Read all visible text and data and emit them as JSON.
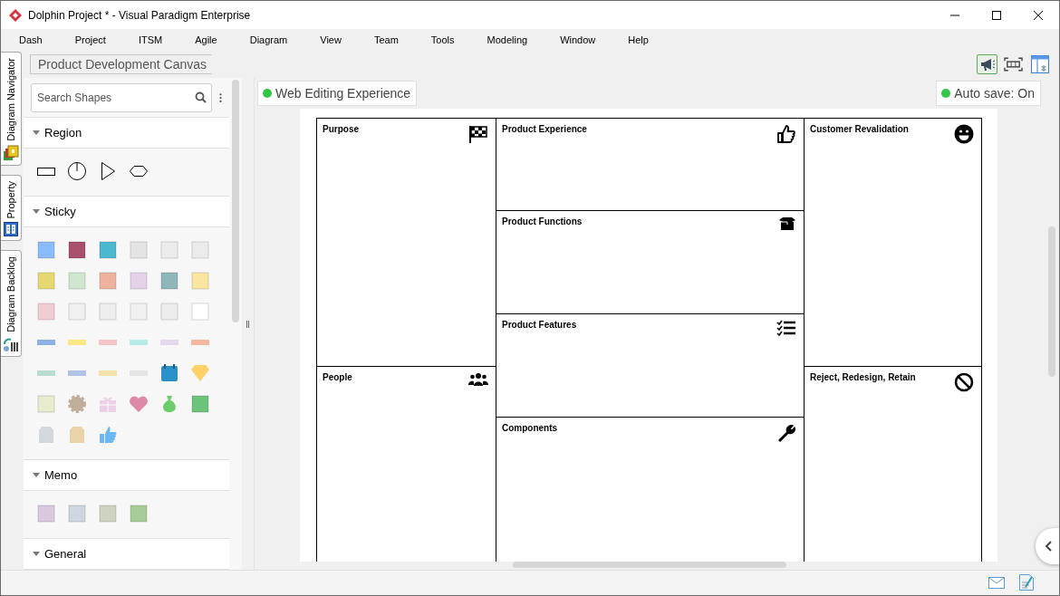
{
  "window": {
    "title": "Dolphin Project * - Visual Paradigm Enterprise"
  },
  "menu": [
    "Dash",
    "Project",
    "ITSM",
    "Agile",
    "Diagram",
    "View",
    "Team",
    "Tools",
    "Modeling",
    "Window",
    "Help"
  ],
  "side_tabs": [
    {
      "label": "Diagram Navigator",
      "kind": "navigator"
    },
    {
      "label": "Property",
      "kind": "property"
    },
    {
      "label": "Diagram Backlog",
      "kind": "backlog"
    }
  ],
  "breadcrumb": "Product Development Canvas",
  "toolbar": [
    {
      "kind": "megaphone",
      "selected": true
    },
    {
      "kind": "fit",
      "selected": false
    },
    {
      "kind": "layout",
      "selected": false
    }
  ],
  "palette": {
    "search": {
      "placeholder": "Search Shapes"
    },
    "sections": [
      {
        "title": "Region",
        "expanded": true,
        "shapes": [
          {
            "kind": "rect"
          },
          {
            "kind": "dial"
          },
          {
            "kind": "triangle"
          },
          {
            "kind": "hexagon"
          }
        ]
      },
      {
        "title": "Sticky",
        "expanded": true,
        "shapes": [
          {
            "kind": "note",
            "color": "#8bbcff"
          },
          {
            "kind": "note",
            "color": "#a8506c"
          },
          {
            "kind": "note",
            "color": "#4bb8d0"
          },
          {
            "kind": "note",
            "color": "#e4e4e4"
          },
          {
            "kind": "note",
            "color": "#ececec"
          },
          {
            "kind": "note",
            "color": "#ebebeb"
          },
          {
            "kind": "note",
            "color": "#e6d870"
          },
          {
            "kind": "note",
            "color": "#cfe6cf"
          },
          {
            "kind": "note",
            "color": "#eeb29e"
          },
          {
            "kind": "note",
            "color": "#e4d2ea"
          },
          {
            "kind": "note",
            "color": "#8fb6b8"
          },
          {
            "kind": "note",
            "color": "#fbe6a0"
          },
          {
            "kind": "note",
            "color": "#f0cdd2"
          },
          {
            "kind": "note",
            "color": "#f0f0f0"
          },
          {
            "kind": "note",
            "color": "#eeeeee"
          },
          {
            "kind": "note",
            "color": "#f1f1f1"
          },
          {
            "kind": "note",
            "color": "#ededed"
          },
          {
            "kind": "note",
            "color": "#ffffff"
          },
          {
            "kind": "tape",
            "color": "#8fb0e6"
          },
          {
            "kind": "tape",
            "color": "#f9e884"
          },
          {
            "kind": "tape",
            "color": "#f7c4cc"
          },
          {
            "kind": "tape",
            "color": "#b6ece4"
          },
          {
            "kind": "tape",
            "color": "#e4d8ec"
          },
          {
            "kind": "tape",
            "color": "#f6b6a0"
          },
          {
            "kind": "tape",
            "color": "#b9dcd0"
          },
          {
            "kind": "tape",
            "color": "#b0c4ea"
          },
          {
            "kind": "tape",
            "color": "#f4e2a8"
          },
          {
            "kind": "tape",
            "color": "#e4e4e4"
          },
          {
            "kind": "calendar",
            "color": "#2b8fc8"
          },
          {
            "kind": "diamond",
            "color": "#ffd166"
          },
          {
            "kind": "note",
            "color": "#e8eccc"
          },
          {
            "kind": "gear",
            "color": "#bfae9a"
          },
          {
            "kind": "gift",
            "color": "#ecd0e6"
          },
          {
            "kind": "heart",
            "color": "#dc8aa8"
          },
          {
            "kind": "bag",
            "color": "#6ccd6c"
          },
          {
            "kind": "note",
            "color": "#6cc47a"
          },
          {
            "kind": "tag",
            "color": "#d4d8de"
          },
          {
            "kind": "tag",
            "color": "#e8d4a8"
          },
          {
            "kind": "thumb",
            "color": "#6cb8f4"
          }
        ]
      },
      {
        "title": "Memo",
        "expanded": true,
        "shapes": [
          {
            "kind": "note",
            "color": "#d8c8e0"
          },
          {
            "kind": "note",
            "color": "#cfd6de"
          },
          {
            "kind": "note",
            "color": "#cfd4c0"
          },
          {
            "kind": "note",
            "color": "#a8cc98"
          }
        ]
      },
      {
        "title": "General",
        "expanded": true
      }
    ]
  },
  "canvas": {
    "tags": [
      {
        "label": "Web Editing Experience",
        "color": "#33c748"
      },
      {
        "label": "Auto save: On",
        "color": "#33c748"
      }
    ],
    "columns": [
      {
        "blocks": [
          {
            "title": "Purpose",
            "kind": "flag"
          },
          {
            "title": "People",
            "kind": "people"
          }
        ]
      },
      {
        "blocks": [
          {
            "title": "Product Experience",
            "kind": "thumb"
          },
          {
            "title": "Product Functions",
            "kind": "box"
          },
          {
            "title": "Product Features",
            "kind": "checklist"
          },
          {
            "title": "Components",
            "kind": "wrench"
          }
        ]
      },
      {
        "blocks": [
          {
            "title": "Customer Revalidation",
            "kind": "smiley"
          },
          {
            "title": "Reject, Redesign, Retain",
            "kind": "ban"
          }
        ]
      }
    ]
  }
}
